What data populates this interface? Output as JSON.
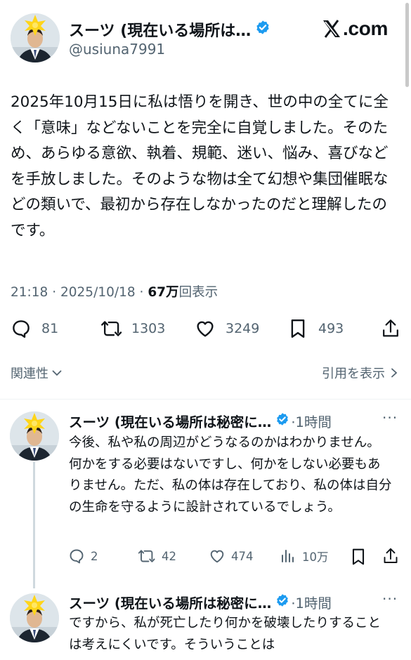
{
  "main": {
    "display_name": "スーツ (現在いる場所は…",
    "handle": "@usiuna7991",
    "site_logo_suffix": ".com",
    "text": "2025年10月15日に私は悟りを開き、世の中の全てに全く「意味」などないことを完全に自覚しました。そのため、あらゆる意欲、執着、規範、迷い、悩み、喜びなどを手放しました。そのような物は全て幻想や集団催眠などの類いで、最初から存在しなかったのだと理解したのです。",
    "time": "21:18",
    "separator": "·",
    "date": "2025/10/18",
    "views_number": "67万",
    "views_label": "回表示",
    "replies": "81",
    "reposts": "1303",
    "likes": "3249",
    "bookmarks": "493",
    "related_label": "関連性",
    "quotes_label": "引用を表示"
  },
  "replies": [
    {
      "display_name": "スーツ (現在いる場所は秘密に…",
      "time_ago": "·1時間",
      "text": "今後、私や私の周辺がどうなるのかはわかりません。何かをする必要はないですし、何かをしない必要もありません。ただ、私の体は存在しており、私の体は自分の生命を守るように設計されているでしょう。",
      "replies": "2",
      "reposts": "42",
      "likes": "474",
      "views": "10万"
    },
    {
      "display_name": "スーツ (現在いる場所は秘密に…",
      "time_ago": "·1時間",
      "text": "ですから、私が死亡したり何かを破壊したりすることは考えにくいです。そういうことは"
    }
  ],
  "colors": {
    "text": "#0f1419",
    "secondary": "#536471",
    "verified": "#1d9bf0",
    "divider": "#eff3f4",
    "thread_line": "#cfd9de"
  }
}
